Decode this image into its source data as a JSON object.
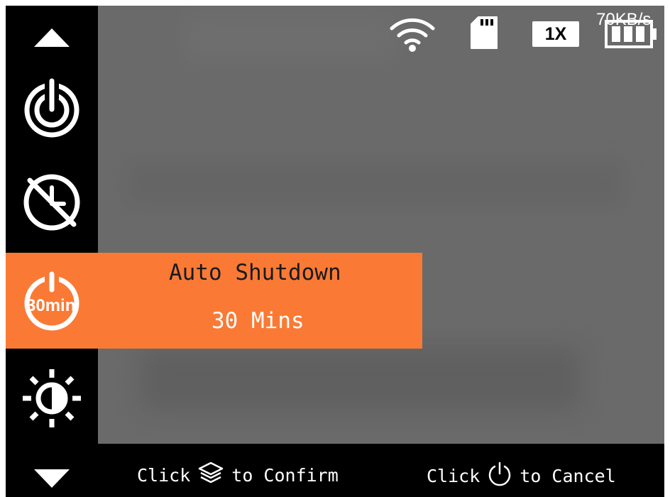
{
  "status_bar": {
    "transfer_speed": "70KB/s",
    "zoom": "1X",
    "icons": [
      "wifi-icon",
      "sd-card-icon",
      "battery-icon"
    ]
  },
  "sidebar": {
    "items": [
      {
        "name": "scroll-up",
        "icon": "triangle-up-icon"
      },
      {
        "name": "power-on",
        "icon": "power-icon"
      },
      {
        "name": "time",
        "icon": "clock-disabled-icon"
      },
      {
        "name": "auto-shutdown",
        "icon": "auto-shutdown-30min-icon",
        "icon_text": "30min"
      },
      {
        "name": "brightness",
        "icon": "sun-icon"
      },
      {
        "name": "scroll-down",
        "icon": "triangle-down-icon"
      }
    ]
  },
  "selected_setting": {
    "title": "Auto Shutdown",
    "value": "30 Mins"
  },
  "footer": {
    "confirm_prefix": "Click",
    "confirm_suffix": "to Confirm",
    "cancel_prefix": "Click",
    "cancel_suffix": "to Cancel"
  },
  "colors": {
    "accent": "#fa7a35",
    "background": "#000000",
    "viewport": "#6a6a6a"
  }
}
